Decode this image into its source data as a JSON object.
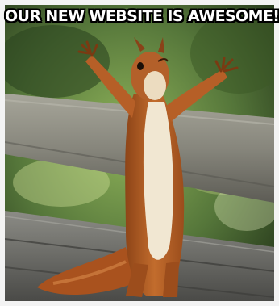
{
  "meme": {
    "caption": "OUR NEW WEBSITE IS AWESOME!",
    "subject": "squirrel-raising-arms-celebrating"
  },
  "colors": {
    "frame": "#f3f3f3",
    "foliage_dark": "#2f4a1f",
    "foliage_light": "#7fa24a",
    "rail": "#8a8a80",
    "bench": "#6e6e6a",
    "fur": "#b8632a",
    "belly": "#f2ead8"
  }
}
